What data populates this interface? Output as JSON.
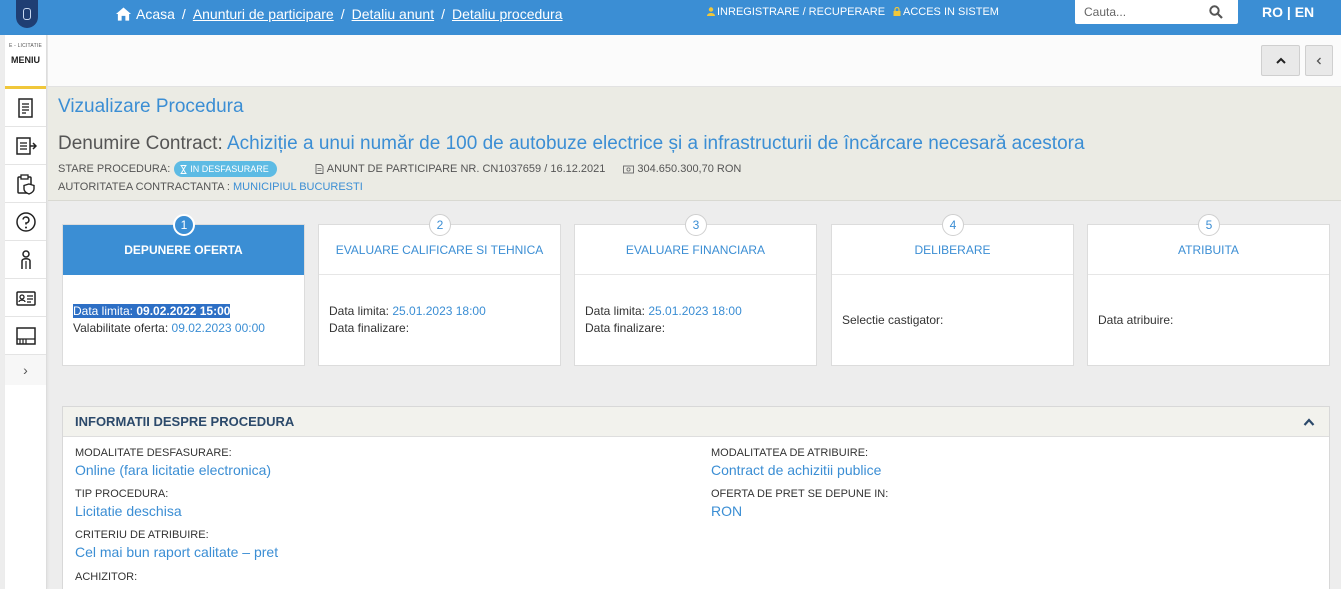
{
  "topbar": {
    "breadcrumb": [
      "Acasa",
      "Anunturi de participare",
      "Detaliu anunt",
      "Detaliu procedura"
    ],
    "register": "INREGISTRARE / RECUPERARE",
    "login": "ACCES IN SISTEM",
    "search_placeholder": "Cauta...",
    "language": "RO | EN"
  },
  "sidebar": {
    "brand_small": "E - LICITATIE",
    "menu_label": "MENIU",
    "items": [
      "document-list-icon",
      "export-list-icon",
      "clipboard-shield-icon",
      "help-icon",
      "user-profile-icon",
      "id-card-icon",
      "catalog-icon"
    ]
  },
  "procedure": {
    "title": "Vizualizare Procedura",
    "contract_label": "Denumire Contract:",
    "contract_name": "Achiziție a unui număr de 100 de autobuze electrice și a infrastructurii de încărcare necesară acestora",
    "status_label": "STARE PROCEDURA:",
    "status": "IN DESFASURARE",
    "notice": "ANUNT DE PARTICIPARE NR. CN1037659 / 16.12.2021",
    "value": "304.650.300,70  RON",
    "authority_label": "AUTORITATEA CONTRACTANTA :",
    "authority": "MUNICIPIUL BUCURESTI"
  },
  "steps": [
    {
      "num": "1",
      "title": "DEPUNERE OFERTA",
      "line1_label": "Data limita: ",
      "line1_value": "09.02.2022 15:00",
      "line2_label": "Valabilitate oferta: ",
      "line2_value": "09.02.2023 00:00"
    },
    {
      "num": "2",
      "title": "EVALUARE CALIFICARE SI TEHNICA",
      "line1_label": "Data limita: ",
      "line1_value": "25.01.2023 18:00",
      "line2_label": "Data finalizare:",
      "line2_value": ""
    },
    {
      "num": "3",
      "title": "EVALUARE FINANCIARA",
      "line1_label": "Data limita: ",
      "line1_value": "25.01.2023 18:00",
      "line2_label": "Data finalizare:",
      "line2_value": ""
    },
    {
      "num": "4",
      "title": "DELIBERARE",
      "line1_label": "Selectie castigator:"
    },
    {
      "num": "5",
      "title": "ATRIBUITA",
      "line1_label": "Data atribuire:"
    }
  ],
  "info": {
    "title": "INFORMATII DESPRE PROCEDURA",
    "fields": [
      {
        "label": "MODALITATE DESFASURARE:",
        "value": "Online (fara licitatie electronica)"
      },
      {
        "label": "MODALITATEA DE ATRIBUIRE:",
        "value": "Contract de achizitii publice"
      },
      {
        "label": "TIP PROCEDURA:",
        "value": "Licitatie deschisa"
      },
      {
        "label": "OFERTA DE PRET SE DEPUNE IN:",
        "value": "RON"
      },
      {
        "label": "CRITERIU DE ATRIBUIRE:",
        "value": "Cel mai bun raport calitate – pret"
      },
      {
        "label": "ACHIZITOR:",
        "value": ""
      }
    ]
  },
  "colors": {
    "primary": "#3b8ed4",
    "badge": "#5dbbe4",
    "accent": "#f0c73b"
  }
}
